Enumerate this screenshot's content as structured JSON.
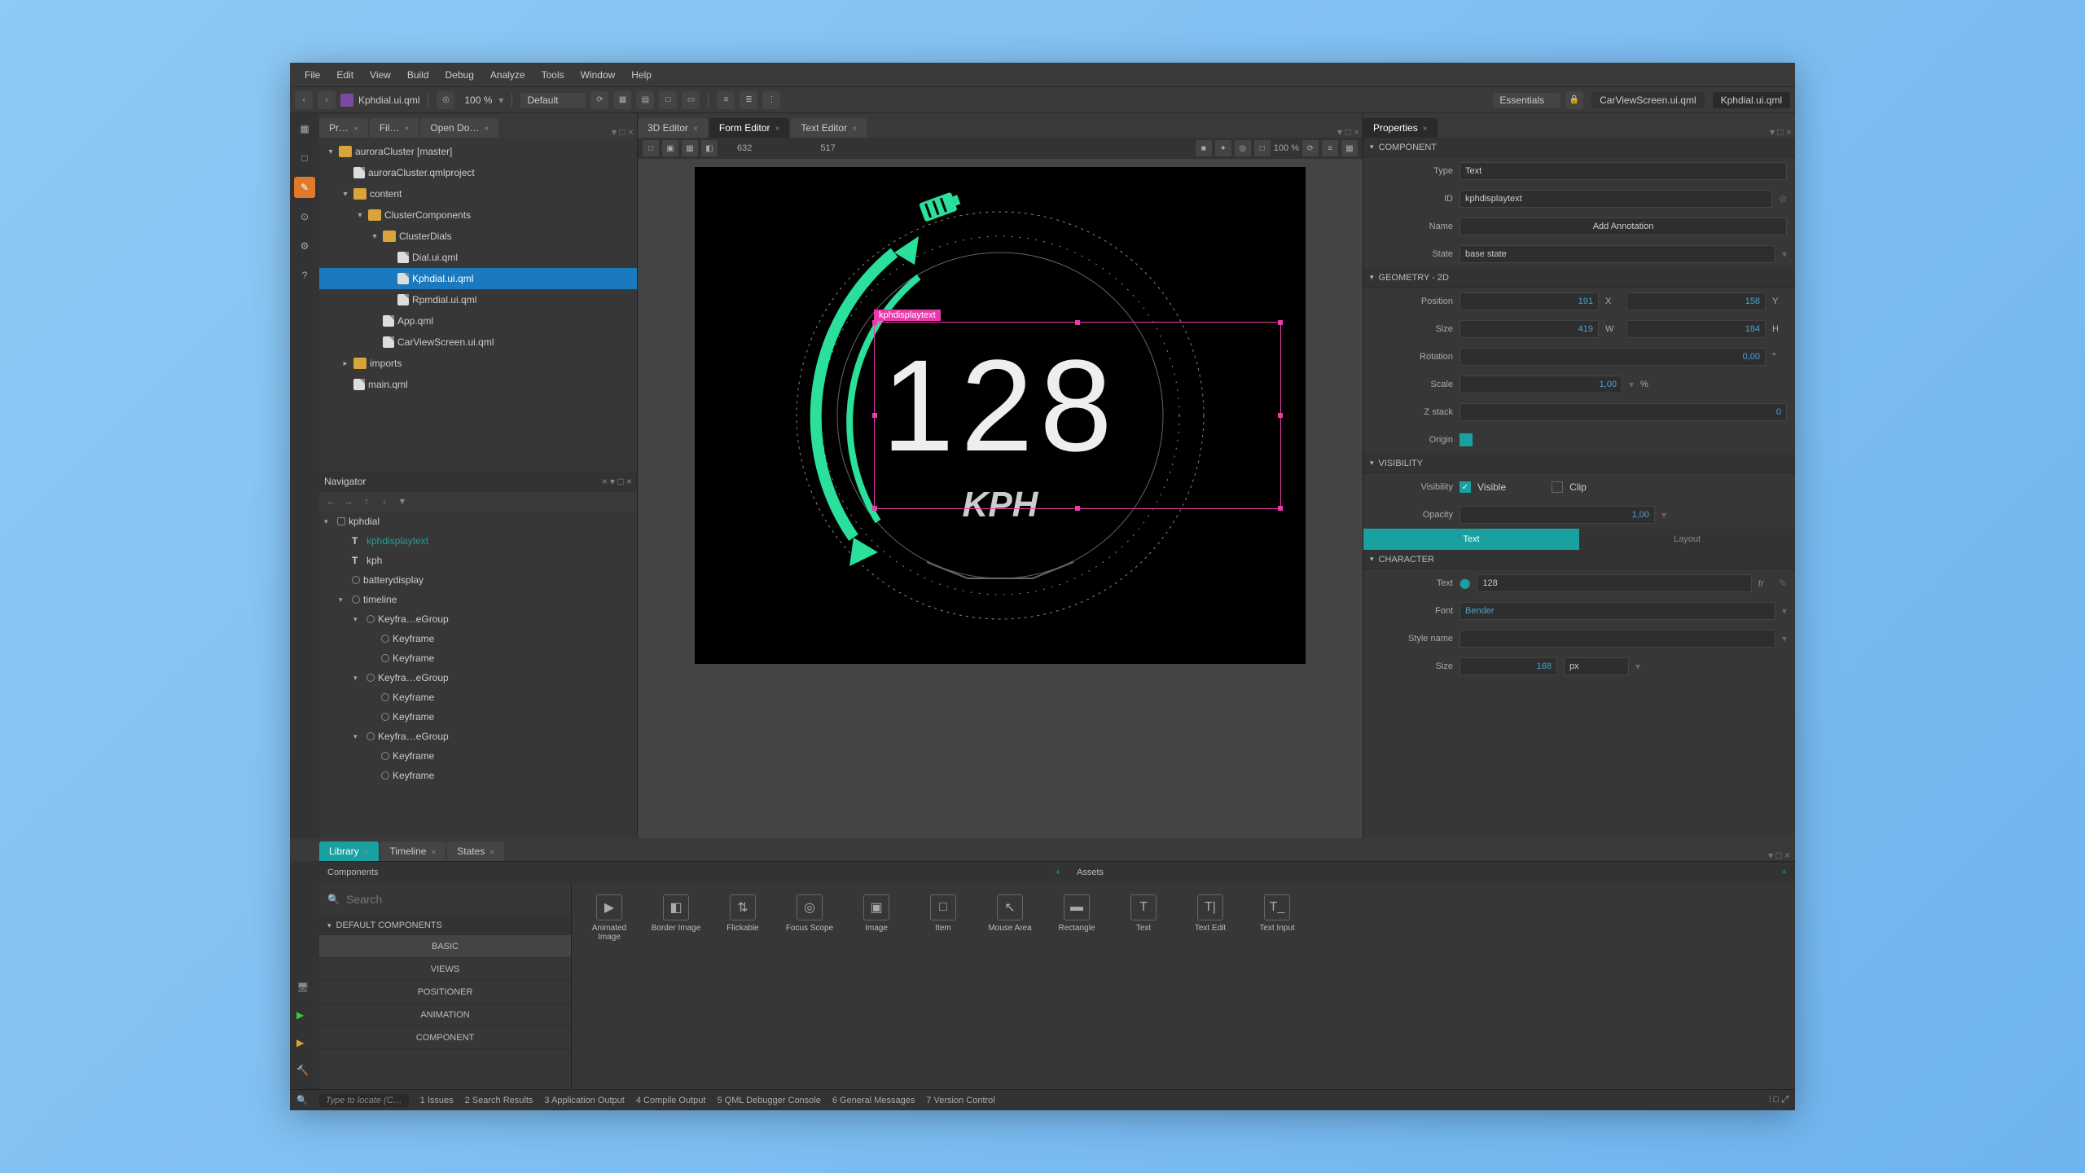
{
  "menu": [
    "File",
    "Edit",
    "View",
    "Build",
    "Debug",
    "Analyze",
    "Tools",
    "Window",
    "Help"
  ],
  "topbar": {
    "file_path": "Kphdial.ui.qml",
    "zoom": "100 %",
    "config": "Default",
    "workspace": "Essentials",
    "open_docs": [
      "CarViewScreen.ui.qml",
      "Kphdial.ui.qml"
    ]
  },
  "editor_tabs": {
    "left": [
      "Pr…",
      "Fil…",
      "Open Do…"
    ],
    "center": [
      "3D Editor",
      "Form Editor",
      "Text Editor"
    ],
    "center_active": 1,
    "right": [
      "Properties"
    ]
  },
  "project_tree": [
    {
      "d": 0,
      "exp": "▾",
      "type": "folder",
      "label": "auroraCluster [master]"
    },
    {
      "d": 1,
      "exp": "",
      "type": "file",
      "label": "auroraCluster.qmlproject"
    },
    {
      "d": 1,
      "exp": "▾",
      "type": "folder",
      "label": "content"
    },
    {
      "d": 2,
      "exp": "▾",
      "type": "folder",
      "label": "ClusterComponents"
    },
    {
      "d": 3,
      "exp": "▾",
      "type": "folder",
      "label": "ClusterDials"
    },
    {
      "d": 4,
      "exp": "",
      "type": "file",
      "label": "Dial.ui.qml"
    },
    {
      "d": 4,
      "exp": "",
      "type": "file",
      "label": "Kphdial.ui.qml",
      "sel": true
    },
    {
      "d": 4,
      "exp": "",
      "type": "file",
      "label": "Rpmdial.ui.qml"
    },
    {
      "d": 3,
      "exp": "",
      "type": "file",
      "label": "App.qml"
    },
    {
      "d": 3,
      "exp": "",
      "type": "file",
      "label": "CarViewScreen.ui.qml"
    },
    {
      "d": 1,
      "exp": "▸",
      "type": "folder",
      "label": "imports"
    },
    {
      "d": 1,
      "exp": "",
      "type": "file",
      "label": "main.qml"
    }
  ],
  "navigator": {
    "title": "Navigator",
    "rows": [
      {
        "d": 0,
        "exp": "▾",
        "icon": "box",
        "label": "kphdial"
      },
      {
        "d": 1,
        "exp": "",
        "icon": "T",
        "label": "kphdisplaytext",
        "hl": true
      },
      {
        "d": 1,
        "exp": "",
        "icon": "T",
        "label": "kph"
      },
      {
        "d": 1,
        "exp": "",
        "icon": "circ",
        "label": "batterydisplay"
      },
      {
        "d": 1,
        "exp": "▾",
        "icon": "circ",
        "label": "timeline"
      },
      {
        "d": 2,
        "exp": "▾",
        "icon": "circ",
        "label": "Keyfra…eGroup"
      },
      {
        "d": 3,
        "exp": "",
        "icon": "circ",
        "label": "Keyframe"
      },
      {
        "d": 3,
        "exp": "",
        "icon": "circ",
        "label": "Keyframe"
      },
      {
        "d": 2,
        "exp": "▾",
        "icon": "circ",
        "label": "Keyfra…eGroup"
      },
      {
        "d": 3,
        "exp": "",
        "icon": "circ",
        "label": "Keyframe"
      },
      {
        "d": 3,
        "exp": "",
        "icon": "circ",
        "label": "Keyframe"
      },
      {
        "d": 2,
        "exp": "▾",
        "icon": "circ",
        "label": "Keyfra…eGroup"
      },
      {
        "d": 3,
        "exp": "",
        "icon": "circ",
        "label": "Keyframe"
      },
      {
        "d": 3,
        "exp": "",
        "icon": "circ",
        "label": "Keyframe"
      }
    ]
  },
  "canvas": {
    "coord_x": "632",
    "coord_y": "517",
    "zoom": "100 %",
    "selection_label": "kphdisplaytext",
    "speed_value": "128",
    "speed_unit": "KPH"
  },
  "properties": {
    "header": "Properties",
    "component": {
      "section": "COMPONENT",
      "type_lbl": "Type",
      "type_val": "Text",
      "id_lbl": "ID",
      "id_val": "kphdisplaytext",
      "name_lbl": "Name",
      "name_btn": "Add Annotation",
      "state_lbl": "State",
      "state_val": "base state"
    },
    "geometry": {
      "section": "GEOMETRY - 2D",
      "pos_lbl": "Position",
      "pos_x": "191",
      "pos_y": "158",
      "size_lbl": "Size",
      "size_w": "419",
      "size_h": "184",
      "rot_lbl": "Rotation",
      "rot_val": "0,00",
      "scale_lbl": "Scale",
      "scale_val": "1,00",
      "z_lbl": "Z stack",
      "z_val": "0",
      "origin_lbl": "Origin"
    },
    "visibility": {
      "section": "VISIBILITY",
      "vis_lbl": "Visibility",
      "visible": "Visible",
      "clip": "Clip",
      "opacity_lbl": "Opacity",
      "opacity_val": "1,00"
    },
    "tabs": {
      "text": "Text",
      "layout": "Layout"
    },
    "character": {
      "section": "CHARACTER",
      "text_lbl": "Text",
      "text_val": "128",
      "tr": "tr",
      "font_lbl": "Font",
      "font_val": "Bender",
      "style_lbl": "Style name",
      "size_lbl": "Size",
      "size_val": "168",
      "size_unit": "px"
    }
  },
  "bottom": {
    "tabs": [
      "Library",
      "Timeline",
      "States"
    ],
    "active": 0,
    "panels": {
      "components": "Components",
      "assets": "Assets"
    },
    "search_placeholder": "Search",
    "cat_header": "DEFAULT COMPONENTS",
    "categories": [
      "BASIC",
      "VIEWS",
      "POSITIONER",
      "ANIMATION",
      "COMPONENT"
    ],
    "cat_active": 0,
    "items": [
      {
        "label": "Animated Image",
        "glyph": "▶"
      },
      {
        "label": "Border Image",
        "glyph": "◧"
      },
      {
        "label": "Flickable",
        "glyph": "⇅"
      },
      {
        "label": "Focus Scope",
        "glyph": "◎"
      },
      {
        "label": "Image",
        "glyph": "▣"
      },
      {
        "label": "Item",
        "glyph": "□"
      },
      {
        "label": "Mouse Area",
        "glyph": "↖"
      },
      {
        "label": "Rectangle",
        "glyph": "▬"
      },
      {
        "label": "Text",
        "glyph": "T"
      },
      {
        "label": "Text Edit",
        "glyph": "T|"
      },
      {
        "label": "Text Input",
        "glyph": "T_"
      }
    ]
  },
  "status": {
    "locator": "Type to locate (C…",
    "items": [
      "1  Issues",
      "2  Search Results",
      "3  Application Output",
      "4  Compile Output",
      "5  QML Debugger Console",
      "6  General Messages",
      "7  Version Control"
    ]
  }
}
